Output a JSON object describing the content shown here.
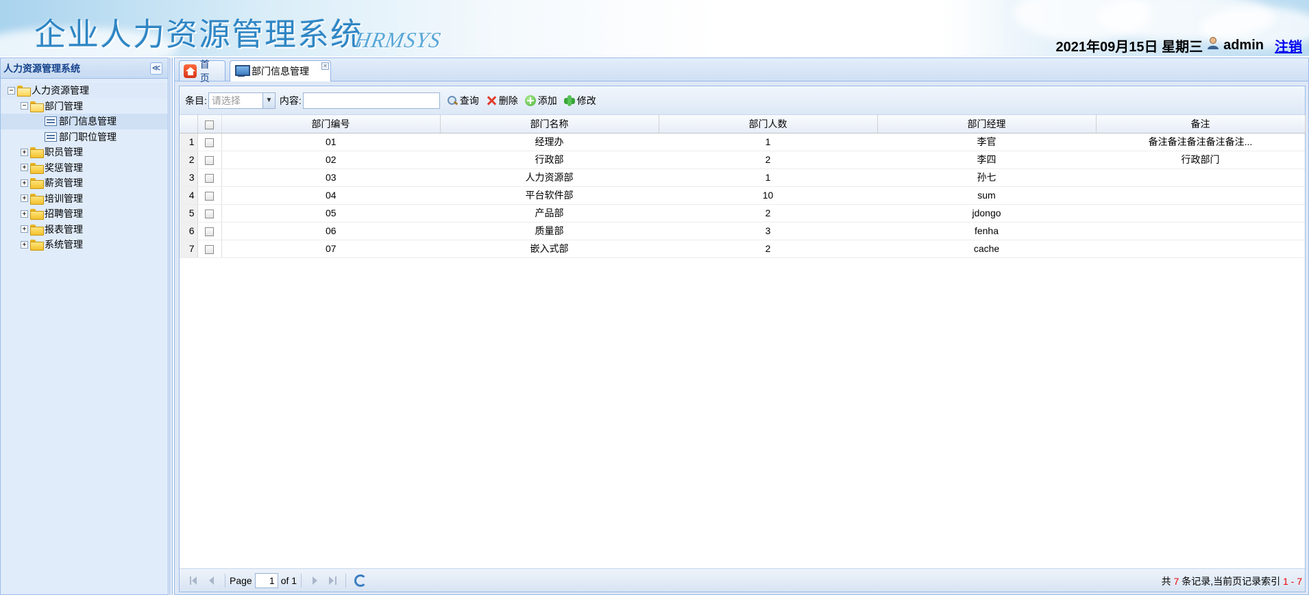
{
  "header": {
    "title": "企业人力资源管理系统",
    "subtitle": "HRMSYS",
    "date": "2021年09月15日 星期三",
    "user": "admin",
    "logout": "注销"
  },
  "left": {
    "title": "人力资源管理系统",
    "collapse": "≪",
    "tree": [
      {
        "label": "人力资源管理",
        "exp": "−"
      },
      {
        "label": "部门管理",
        "exp": "−"
      },
      {
        "label": "部门信息管理"
      },
      {
        "label": "部门职位管理"
      },
      {
        "label": "职员管理",
        "exp": "+"
      },
      {
        "label": "奖惩管理",
        "exp": "+"
      },
      {
        "label": "薪资管理",
        "exp": "+"
      },
      {
        "label": "培训管理",
        "exp": "+"
      },
      {
        "label": "招聘管理",
        "exp": "+"
      },
      {
        "label": "报表管理",
        "exp": "+"
      },
      {
        "label": "系统管理",
        "exp": "+"
      }
    ]
  },
  "tabs": [
    {
      "label": "首页"
    },
    {
      "label": "部门信息管理",
      "close": "×"
    }
  ],
  "toolbar": {
    "field_label": "条目:",
    "select_placeholder": "请选择",
    "select_arrow": "▼",
    "content_label": "内容:",
    "search": "查询",
    "delete": "删除",
    "add": "添加",
    "edit": "修改"
  },
  "grid": {
    "columns": [
      "部门编号",
      "部门名称",
      "部门人数",
      "部门经理",
      "备注"
    ],
    "rows": [
      {
        "n": "1",
        "id": "01",
        "name": "经理办",
        "count": "1",
        "manager": "李官",
        "note": "备注备注备注备注备注..."
      },
      {
        "n": "2",
        "id": "02",
        "name": "行政部",
        "count": "2",
        "manager": "李四",
        "note": "行政部门"
      },
      {
        "n": "3",
        "id": "03",
        "name": "人力资源部",
        "count": "1",
        "manager": "孙七",
        "note": ""
      },
      {
        "n": "4",
        "id": "04",
        "name": "平台软件部",
        "count": "10",
        "manager": "sum",
        "note": ""
      },
      {
        "n": "5",
        "id": "05",
        "name": "产品部",
        "count": "2",
        "manager": "jdongo",
        "note": ""
      },
      {
        "n": "6",
        "id": "06",
        "name": "质量部",
        "count": "3",
        "manager": "fenha",
        "note": ""
      },
      {
        "n": "7",
        "id": "07",
        "name": "嵌入式部",
        "count": "2",
        "manager": "cache",
        "note": ""
      }
    ]
  },
  "pager": {
    "page_label": "Page",
    "page_value": "1",
    "of_label": "of 1",
    "info_prefix": "共",
    "total": "7",
    "info_mid": "条记录,当前页记录索引",
    "range": "1 - 7"
  }
}
